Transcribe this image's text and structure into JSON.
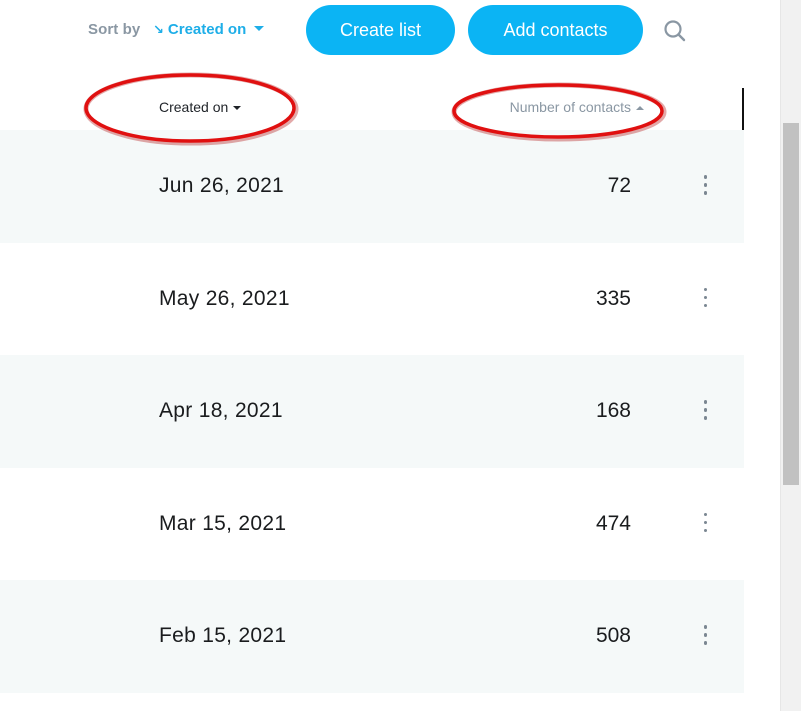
{
  "toolbar": {
    "sort_label": "Sort by",
    "sort_arrow": "↘",
    "sort_value": "Created on",
    "create_list_label": "Create list",
    "add_contacts_label": "Add contacts",
    "search_icon": "search-icon"
  },
  "table": {
    "headers": {
      "created_on": "Created on",
      "number_of_contacts": "Number of contacts"
    },
    "rows": [
      {
        "date": "Jun 26, 2021",
        "count": "72"
      },
      {
        "date": "May 26, 2021",
        "count": "335"
      },
      {
        "date": "Apr 18, 2021",
        "count": "168"
      },
      {
        "date": "Mar 15, 2021",
        "count": "474"
      },
      {
        "date": "Feb 15, 2021",
        "count": "508"
      }
    ]
  },
  "colors": {
    "accent": "#0bb4f4",
    "sort_link": "#1eaee8",
    "annotation": "#e01010",
    "row_shade": "#f5f9f9"
  }
}
